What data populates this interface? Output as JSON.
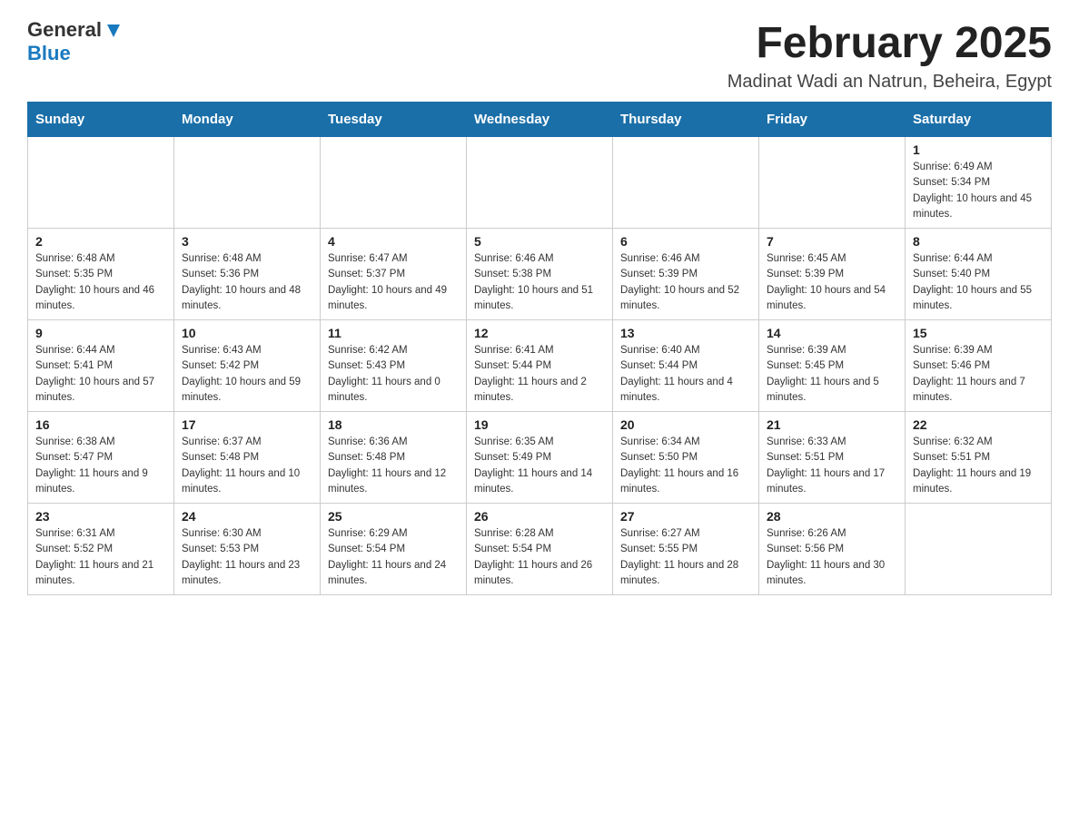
{
  "header": {
    "logo_general": "General",
    "logo_blue": "Blue",
    "month_title": "February 2025",
    "location": "Madinat Wadi an Natrun, Beheira, Egypt"
  },
  "days_of_week": [
    "Sunday",
    "Monday",
    "Tuesday",
    "Wednesday",
    "Thursday",
    "Friday",
    "Saturday"
  ],
  "weeks": [
    [
      {
        "day": "",
        "info": ""
      },
      {
        "day": "",
        "info": ""
      },
      {
        "day": "",
        "info": ""
      },
      {
        "day": "",
        "info": ""
      },
      {
        "day": "",
        "info": ""
      },
      {
        "day": "",
        "info": ""
      },
      {
        "day": "1",
        "info": "Sunrise: 6:49 AM\nSunset: 5:34 PM\nDaylight: 10 hours and 45 minutes."
      }
    ],
    [
      {
        "day": "2",
        "info": "Sunrise: 6:48 AM\nSunset: 5:35 PM\nDaylight: 10 hours and 46 minutes."
      },
      {
        "day": "3",
        "info": "Sunrise: 6:48 AM\nSunset: 5:36 PM\nDaylight: 10 hours and 48 minutes."
      },
      {
        "day": "4",
        "info": "Sunrise: 6:47 AM\nSunset: 5:37 PM\nDaylight: 10 hours and 49 minutes."
      },
      {
        "day": "5",
        "info": "Sunrise: 6:46 AM\nSunset: 5:38 PM\nDaylight: 10 hours and 51 minutes."
      },
      {
        "day": "6",
        "info": "Sunrise: 6:46 AM\nSunset: 5:39 PM\nDaylight: 10 hours and 52 minutes."
      },
      {
        "day": "7",
        "info": "Sunrise: 6:45 AM\nSunset: 5:39 PM\nDaylight: 10 hours and 54 minutes."
      },
      {
        "day": "8",
        "info": "Sunrise: 6:44 AM\nSunset: 5:40 PM\nDaylight: 10 hours and 55 minutes."
      }
    ],
    [
      {
        "day": "9",
        "info": "Sunrise: 6:44 AM\nSunset: 5:41 PM\nDaylight: 10 hours and 57 minutes."
      },
      {
        "day": "10",
        "info": "Sunrise: 6:43 AM\nSunset: 5:42 PM\nDaylight: 10 hours and 59 minutes."
      },
      {
        "day": "11",
        "info": "Sunrise: 6:42 AM\nSunset: 5:43 PM\nDaylight: 11 hours and 0 minutes."
      },
      {
        "day": "12",
        "info": "Sunrise: 6:41 AM\nSunset: 5:44 PM\nDaylight: 11 hours and 2 minutes."
      },
      {
        "day": "13",
        "info": "Sunrise: 6:40 AM\nSunset: 5:44 PM\nDaylight: 11 hours and 4 minutes."
      },
      {
        "day": "14",
        "info": "Sunrise: 6:39 AM\nSunset: 5:45 PM\nDaylight: 11 hours and 5 minutes."
      },
      {
        "day": "15",
        "info": "Sunrise: 6:39 AM\nSunset: 5:46 PM\nDaylight: 11 hours and 7 minutes."
      }
    ],
    [
      {
        "day": "16",
        "info": "Sunrise: 6:38 AM\nSunset: 5:47 PM\nDaylight: 11 hours and 9 minutes."
      },
      {
        "day": "17",
        "info": "Sunrise: 6:37 AM\nSunset: 5:48 PM\nDaylight: 11 hours and 10 minutes."
      },
      {
        "day": "18",
        "info": "Sunrise: 6:36 AM\nSunset: 5:48 PM\nDaylight: 11 hours and 12 minutes."
      },
      {
        "day": "19",
        "info": "Sunrise: 6:35 AM\nSunset: 5:49 PM\nDaylight: 11 hours and 14 minutes."
      },
      {
        "day": "20",
        "info": "Sunrise: 6:34 AM\nSunset: 5:50 PM\nDaylight: 11 hours and 16 minutes."
      },
      {
        "day": "21",
        "info": "Sunrise: 6:33 AM\nSunset: 5:51 PM\nDaylight: 11 hours and 17 minutes."
      },
      {
        "day": "22",
        "info": "Sunrise: 6:32 AM\nSunset: 5:51 PM\nDaylight: 11 hours and 19 minutes."
      }
    ],
    [
      {
        "day": "23",
        "info": "Sunrise: 6:31 AM\nSunset: 5:52 PM\nDaylight: 11 hours and 21 minutes."
      },
      {
        "day": "24",
        "info": "Sunrise: 6:30 AM\nSunset: 5:53 PM\nDaylight: 11 hours and 23 minutes."
      },
      {
        "day": "25",
        "info": "Sunrise: 6:29 AM\nSunset: 5:54 PM\nDaylight: 11 hours and 24 minutes."
      },
      {
        "day": "26",
        "info": "Sunrise: 6:28 AM\nSunset: 5:54 PM\nDaylight: 11 hours and 26 minutes."
      },
      {
        "day": "27",
        "info": "Sunrise: 6:27 AM\nSunset: 5:55 PM\nDaylight: 11 hours and 28 minutes."
      },
      {
        "day": "28",
        "info": "Sunrise: 6:26 AM\nSunset: 5:56 PM\nDaylight: 11 hours and 30 minutes."
      },
      {
        "day": "",
        "info": ""
      }
    ]
  ]
}
